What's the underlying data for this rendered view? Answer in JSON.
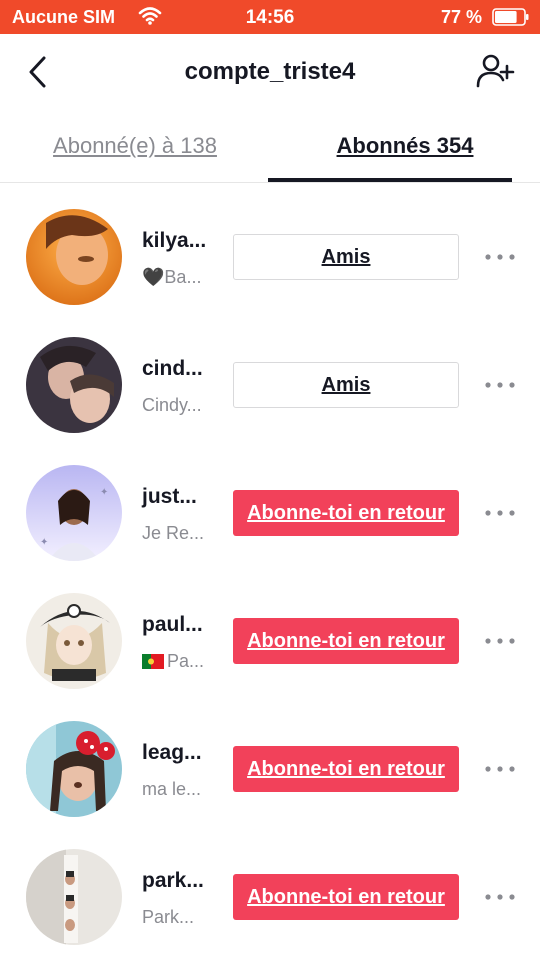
{
  "status_bar": {
    "carrier": "Aucune SIM",
    "time": "14:56",
    "battery": "77 %",
    "battery_level": 0.77,
    "wifi_icon": "wifi-icon"
  },
  "header": {
    "title": "compte_triste4",
    "back_icon": "back-chevron-icon",
    "add_user_icon": "add-user-icon"
  },
  "tabs": [
    {
      "label": "Abonné(e) à 138",
      "active": false
    },
    {
      "label": "Abonnés 354",
      "active": true
    }
  ],
  "followers": [
    {
      "name": "kilya...",
      "subtitle": "Ba...",
      "subtitle_prefix": "🖤",
      "button": "Amis",
      "button_type": "friends",
      "more_icon": "more-dots-icon"
    },
    {
      "name": "cind...",
      "subtitle": "Cindy...",
      "subtitle_prefix": "",
      "button": "Amis",
      "button_type": "friends",
      "more_icon": "more-dots-icon"
    },
    {
      "name": "just...",
      "subtitle": "Je Re...",
      "subtitle_prefix": "",
      "button": "Abonne-toi en retour",
      "button_type": "follow",
      "more_icon": "more-dots-icon"
    },
    {
      "name": "paul...",
      "subtitle": "Pa...",
      "subtitle_prefix": "portugal-flag",
      "button": "Abonne-toi en retour",
      "button_type": "follow",
      "more_icon": "more-dots-icon"
    },
    {
      "name": "leag...",
      "subtitle": "ma le...",
      "subtitle_prefix": "",
      "button": "Abonne-toi en retour",
      "button_type": "follow",
      "more_icon": "more-dots-icon"
    },
    {
      "name": "park...",
      "subtitle": "Park...",
      "subtitle_prefix": "",
      "button": "Abonne-toi en retour",
      "button_type": "follow",
      "more_icon": "more-dots-icon"
    }
  ],
  "colors": {
    "status_bar": "#f04a2a",
    "follow_button": "#f2415a",
    "text_primary": "#161823",
    "text_secondary": "#8a8b91"
  }
}
